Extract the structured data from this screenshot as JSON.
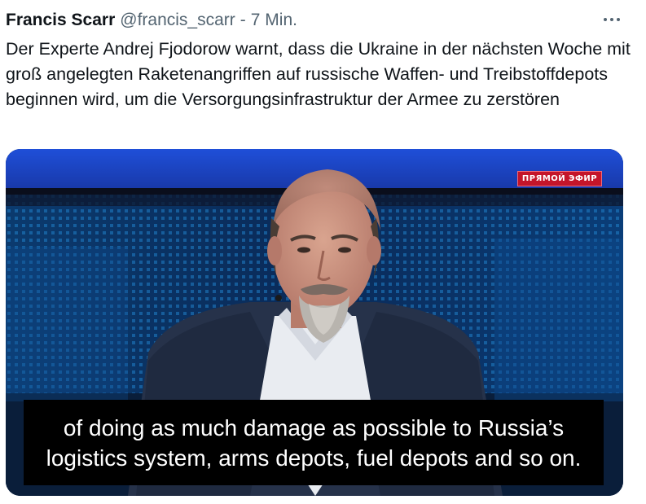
{
  "tweet": {
    "author_name": "Francis Scarr",
    "handle": "@francis_scarr",
    "separator": "-",
    "time": "7 Min.",
    "more_icon": "more-horizontal-icon",
    "text": "Der Experte Andrej Fjodorow warnt, dass die Ukraine in der nächsten Woche mit groß angelegten Raketenangriffen auf russische Waffen- und Treibstoffdepots beginnen wird, um die Versorgungsinfrastruktur der Armee zu zerstören"
  },
  "video": {
    "live_badge": "ПРЯМОЙ ЭФИР",
    "subtitle_line1": "of doing as much damage as possible to Russia’s",
    "subtitle_line2": "logistics system, arms depots, fuel depots and so on."
  },
  "colors": {
    "text_primary": "#0f1419",
    "text_secondary": "#536471",
    "badge_red": "#c4152a",
    "studio_blue": "#1a45c8"
  }
}
